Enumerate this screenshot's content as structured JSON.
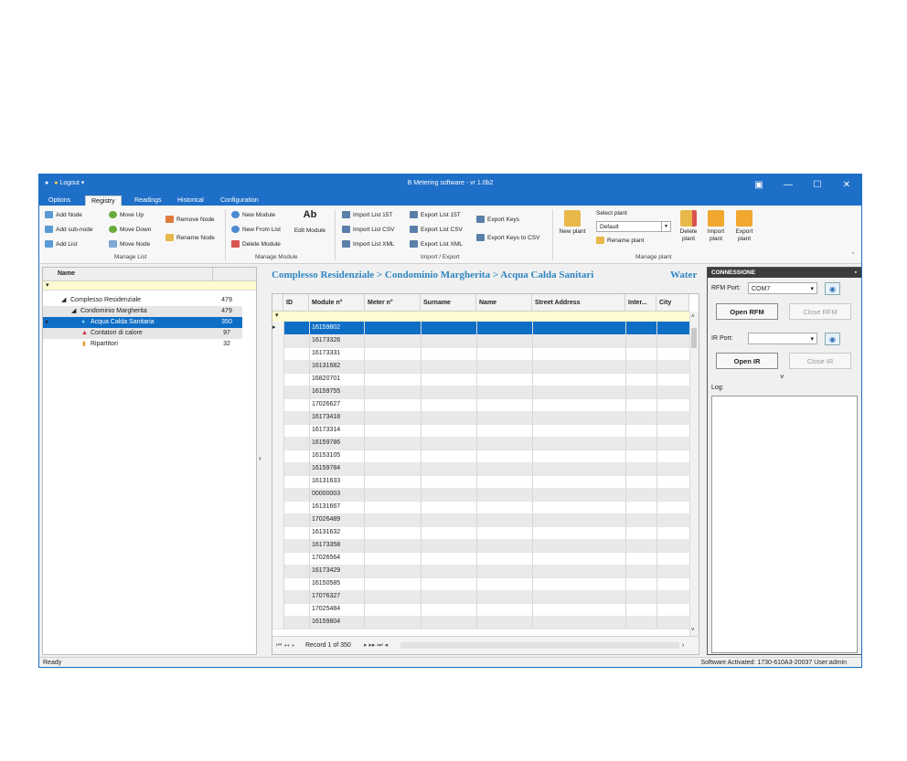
{
  "titlebar": {
    "logout": "Logout",
    "title": "B Metering software - vr 1.0b2"
  },
  "tabs": [
    "Options",
    "Registry",
    "Readings",
    "Historical",
    "Configuration"
  ],
  "ribbon": {
    "manage_list": {
      "add_node": "Add Node",
      "add_subnode": "Add sub-node",
      "add_list": "Add List",
      "move_up": "Move Up",
      "move_down": "Move Down",
      "move_node": "Move Node",
      "remove_node": "Remove Node",
      "rename_node": "Rename Node",
      "label": "Manage List"
    },
    "manage_module": {
      "new_module": "New Module",
      "new_from_list": "New From List",
      "delete_module": "Delete Module",
      "edit_module": "Edit Module",
      "label": "Manage Module"
    },
    "import_export": {
      "import_15t": "Import List 15T",
      "import_csv": "Import List CSV",
      "import_xml": "Import List XML",
      "export_15t": "Export List 15T",
      "export_csv": "Export List CSV",
      "export_xml": "Export List XML",
      "export_keys": "Export Keys",
      "export_keys_csv": "Export Keys to CSV",
      "label": "Import / Export"
    },
    "manage_plant": {
      "new_plant": "New plant",
      "select_plant": "Select plant",
      "plant_value": "Default",
      "rename_plant": "Rename plant",
      "delete_plant": "Delete plant",
      "import_plant": "Import plant",
      "export_plant": "Export plant",
      "label": "Manage plant"
    }
  },
  "tree": {
    "header": "Name",
    "rows": [
      {
        "label": "Complesso Residenziale",
        "count": "479"
      },
      {
        "label": "Condominio Margherita",
        "count": "479"
      },
      {
        "label": "Acqua Calda Sanitaria",
        "count": "350"
      },
      {
        "label": "Contatori di calore",
        "count": "97"
      },
      {
        "label": "Ripartitori",
        "count": "32"
      }
    ]
  },
  "breadcrumb": "Complesso Residenziale > Condominio Margherita > Acqua Calda Sanitari",
  "category": "Water",
  "grid": {
    "columns": [
      "ID",
      "Module n°",
      "Meter n°",
      "Surname",
      "Name",
      "Street Address",
      "Inter...",
      "City"
    ],
    "modules": [
      "16159802",
      "16173326",
      "16173331",
      "16131682",
      "16820701",
      "16159755",
      "17026627",
      "16173418",
      "16173314",
      "16159786",
      "16153105",
      "16159784",
      "16131633",
      "00000003",
      "16131667",
      "17026489",
      "16131632",
      "16173358",
      "17026564",
      "16173429",
      "16150585",
      "17076327",
      "17025484",
      "16159804"
    ],
    "record_text": "Record 1 of 350"
  },
  "connection": {
    "title": "CONNESSIONE",
    "rfm_label": "RFM Port:",
    "rfm_value": "COM7",
    "open_rfm": "Open RFM",
    "close_rfm": "Close RFM",
    "ir_label": "IR Port:",
    "ir_value": "",
    "open_ir": "Open IR",
    "close_ir": "Close IR",
    "log_label": "Log:"
  },
  "status": {
    "left": "Ready",
    "right": "Software Activated: 1730-610A3-20037   User:admin"
  }
}
